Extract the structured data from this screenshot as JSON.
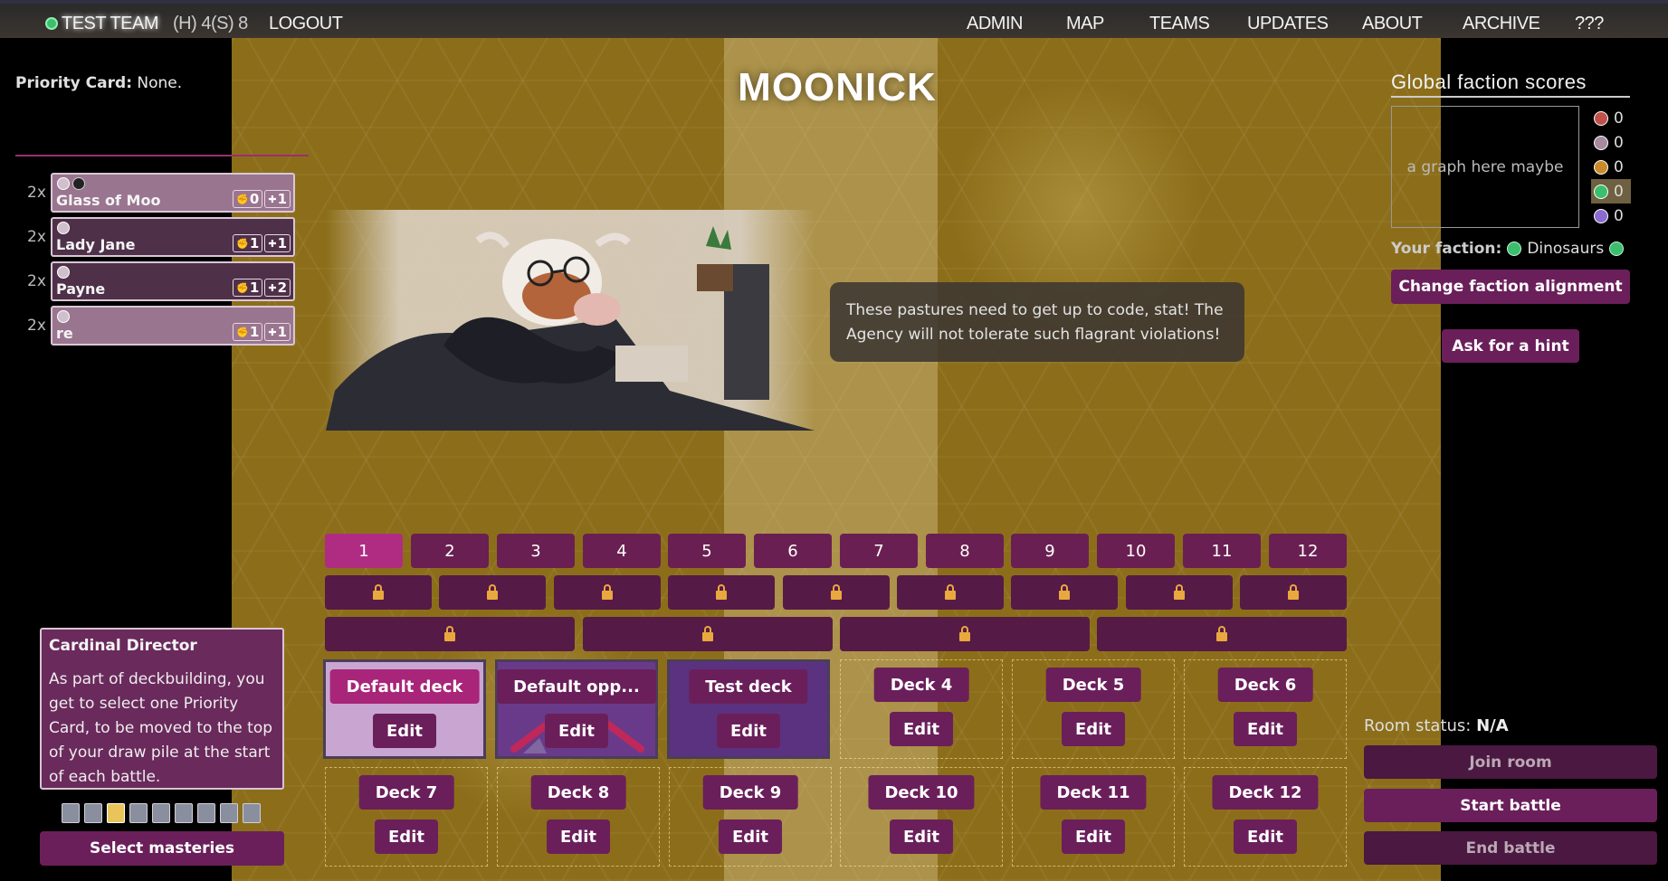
{
  "nav": {
    "team": "TEST TEAM",
    "hs": "(H) 4(S) 8",
    "logout": "LOGOUT",
    "links": [
      "ADMIN",
      "MAP",
      "TEAMS",
      "UPDATES",
      "ABOUT",
      "ARCHIVE",
      "???"
    ]
  },
  "left": {
    "priority_label": "Priority Card:",
    "priority_value": "None.",
    "cards": [
      {
        "qty": "2x",
        "name": "Glass of Moo",
        "atk": "0",
        "hp": "1"
      },
      {
        "qty": "2x",
        "name": "Lady Jane",
        "atk": "1",
        "hp": "1"
      },
      {
        "qty": "2x",
        "name": "Payne",
        "atk": "1",
        "hp": "2"
      },
      {
        "qty": "2x",
        "name": "re",
        "atk": "1",
        "hp": "1"
      }
    ],
    "tooltip": {
      "title": "Cardinal Director",
      "text": "As part of deckbuilding, you get to select one Priority Card, to be moved to the top of your draw pile at the start of each battle."
    },
    "select_masteries": "Select masteries"
  },
  "center": {
    "title": "MOONICK",
    "speech": "These pastures need to get up to code, stat! The Agency will not tolerate such flagrant violations!",
    "levels": [
      "1",
      "2",
      "3",
      "4",
      "5",
      "6",
      "7",
      "8",
      "9",
      "10",
      "11",
      "12"
    ],
    "decks": [
      {
        "name": "Default deck",
        "edit": "Edit"
      },
      {
        "name": "Default opp...",
        "edit": "Edit"
      },
      {
        "name": "Test deck",
        "edit": "Edit"
      },
      {
        "name": "Deck 4",
        "edit": "Edit"
      },
      {
        "name": "Deck 5",
        "edit": "Edit"
      },
      {
        "name": "Deck 6",
        "edit": "Edit"
      },
      {
        "name": "Deck 7",
        "edit": "Edit"
      },
      {
        "name": "Deck 8",
        "edit": "Edit"
      },
      {
        "name": "Deck 9",
        "edit": "Edit"
      },
      {
        "name": "Deck 10",
        "edit": "Edit"
      },
      {
        "name": "Deck 11",
        "edit": "Edit"
      },
      {
        "name": "Deck 12",
        "edit": "Edit"
      }
    ]
  },
  "right": {
    "scores_title": "Global faction scores",
    "graph_placeholder": "a graph here maybe",
    "scores": [
      {
        "icon": "red-faction-icon",
        "color": "#c0504a",
        "value": "0"
      },
      {
        "icon": "pink-faction-icon",
        "color": "#a78aa0",
        "value": "0"
      },
      {
        "icon": "orange-faction-icon",
        "color": "#c98a2a",
        "value": "0"
      },
      {
        "icon": "dinosaur-faction-icon",
        "color": "#3bbf6e",
        "value": "0"
      },
      {
        "icon": "purple-faction-icon",
        "color": "#8a6bd0",
        "value": "0"
      }
    ],
    "faction_label": "Your faction:",
    "faction_name": "Dinosaurs",
    "change_faction": "Change faction alignment",
    "hint": "Ask for a hint",
    "room_status_label": "Room status:",
    "room_status_value": "N/A",
    "join": "Join room",
    "start": "Start battle",
    "end": "End battle"
  }
}
